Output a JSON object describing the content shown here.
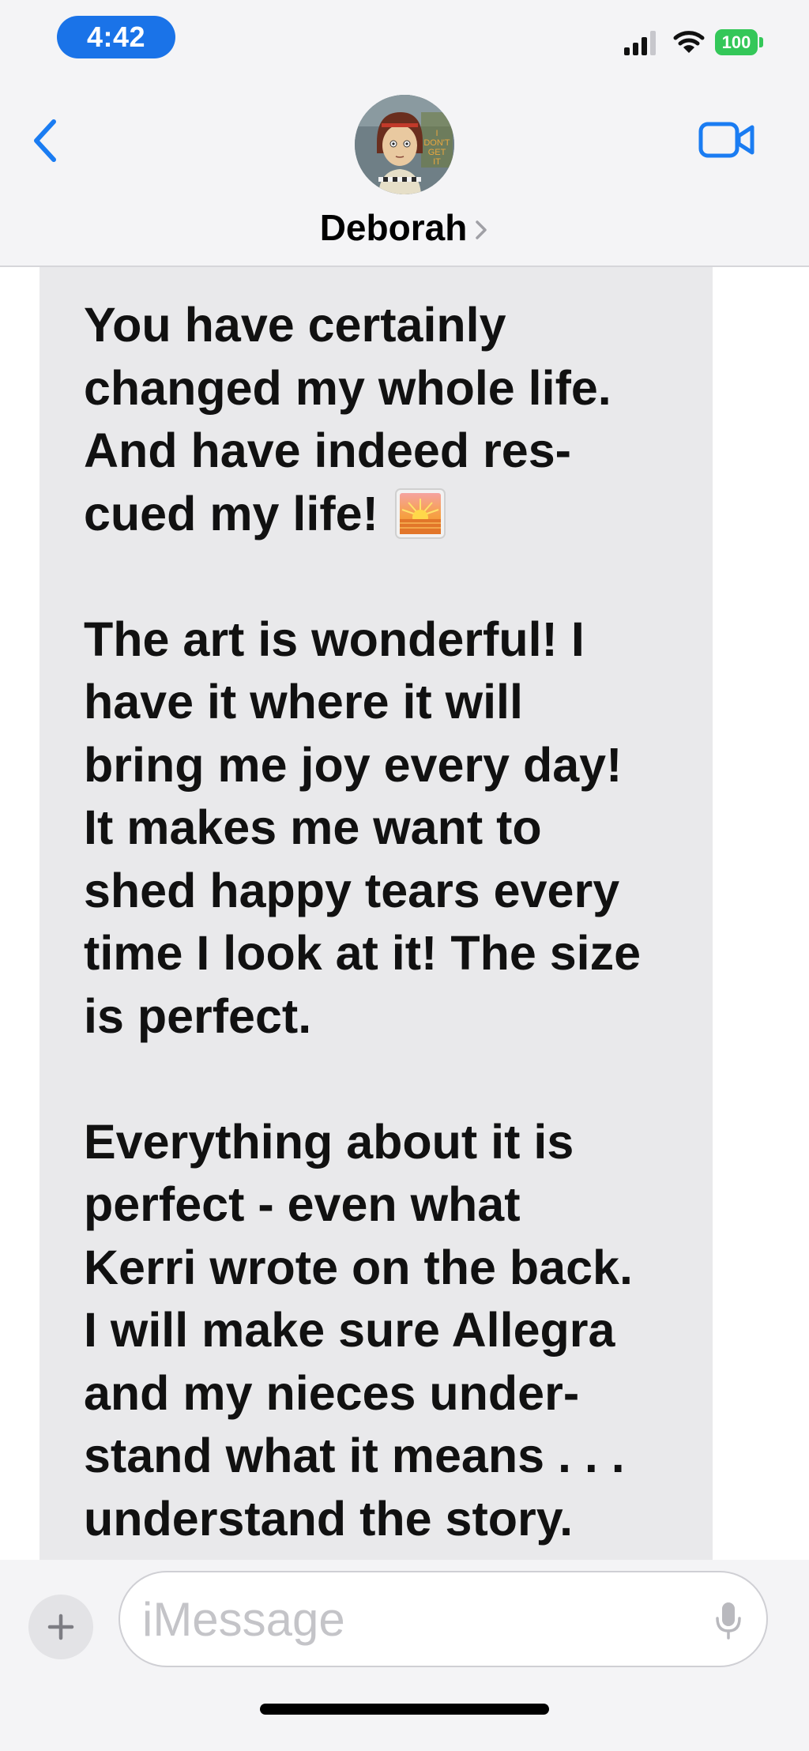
{
  "status_bar": {
    "time": "4:42",
    "battery": "100",
    "time_pill_color": "#1a73e8",
    "battery_color": "#34c759"
  },
  "header": {
    "contact_name": "Deborah",
    "back_icon": "chevron-left-icon",
    "video_icon": "video-camera-icon",
    "accent_color": "#1a7cf2"
  },
  "message": {
    "bubble_color": "#e9e9eb",
    "emoji": "sunrise-emoji",
    "lines": [
      "You have certainly",
      "changed my whole life.",
      "And have indeed res-",
      "cued my life!",
      "",
      "The art is wonderful! I",
      "have it where it will",
      "bring me joy every day!",
      "It makes me want to",
      "shed happy tears every",
      "time I look at it! The size",
      "is perfect.",
      "",
      "Everything about it is",
      "perfect - even what",
      "Kerri wrote on the back.",
      "I will make sure Allegra",
      "and my nieces under-",
      "stand what it means . . .",
      "understand the story."
    ]
  },
  "input_bar": {
    "placeholder": "iMessage",
    "plus_icon": "plus-icon",
    "mic_icon": "microphone-icon"
  }
}
